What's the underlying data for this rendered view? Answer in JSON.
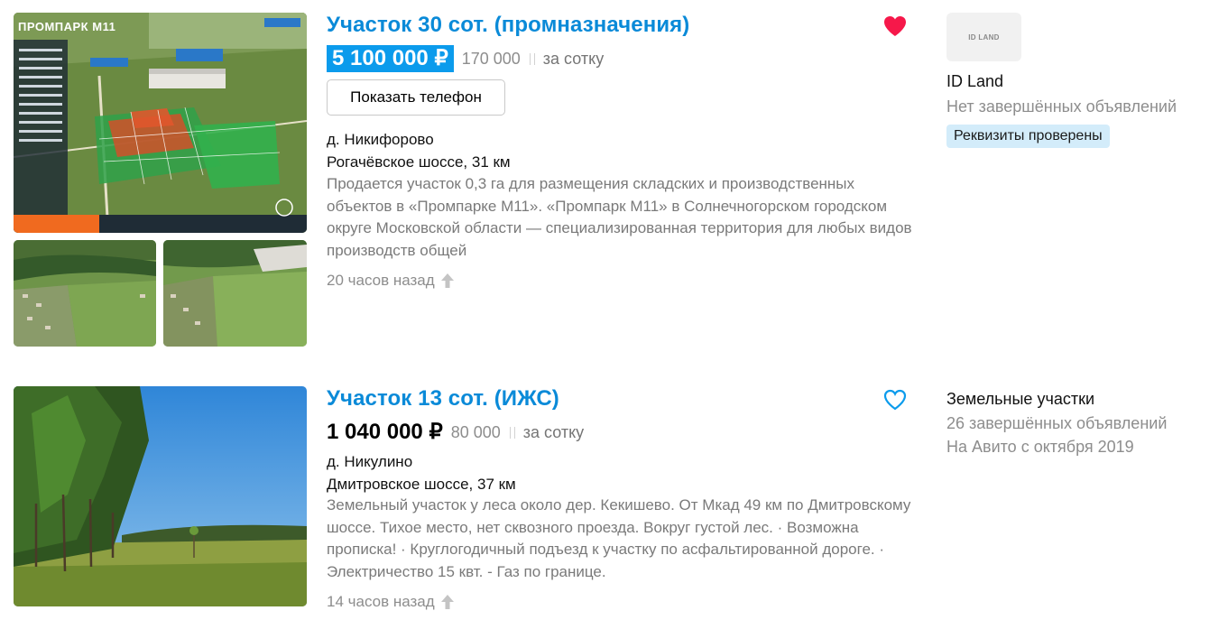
{
  "listings": [
    {
      "title": "Участок 30 сот. (промназначения)",
      "price": "5 100 000 ₽",
      "price_per_unit": "170 000",
      "per_unit_label": "за сотку",
      "phone_button": "Показать телефон",
      "location": "д. Никифорово",
      "highway": "Рогачёвское шоссе, 31 км",
      "description": "Продается участок 0,3 га для размещения складских и производственных объектов в «Промпарке М11». «Промпарк М11» в Солнечногорском городском округе Московской области — специализированная территория для любых видов производств общей",
      "time": "20 часов назад",
      "favorited": true,
      "photo_banner": "ПРОМПАРК М11",
      "seller": {
        "logo_text": "ID LAND",
        "name": "ID Land",
        "stats": "Нет завершённых объявлений",
        "badge": "Реквизиты проверены"
      }
    },
    {
      "title": "Участок 13 сот. (ИЖС)",
      "price": "1 040 000 ₽",
      "price_per_unit": "80 000",
      "per_unit_label": "за сотку",
      "location": "д. Никулино",
      "highway": "Дмитровское шоссе, 37 км",
      "description": "Земельный участок у леса около дер. Кекишево. От Мкад 49 км по Дмитровскому шоссе. Тихое место, нет сквозного проезда. Вокруг густой лес. · Возможна прописка! · Круглогодичный подъезд к участку по асфальтированной дороге. · Электричество 15 квт. - Газ по границе.",
      "time": "14 часов назад",
      "favorited": false,
      "seller": {
        "name": "Земельные участки",
        "stats": "26 завершённых объявлений",
        "since": "На Авито с октября 2019"
      }
    }
  ],
  "colors": {
    "title_blue": "#0a8ad8",
    "price_highlight": "#0b9bec",
    "heart_red": "#f6184a",
    "heart_outline": "#0b9bec",
    "badge_bg": "#d3ecfa"
  },
  "icons": [
    "heart-filled-icon",
    "heart-outline-icon",
    "raise-arrow-icon"
  ]
}
